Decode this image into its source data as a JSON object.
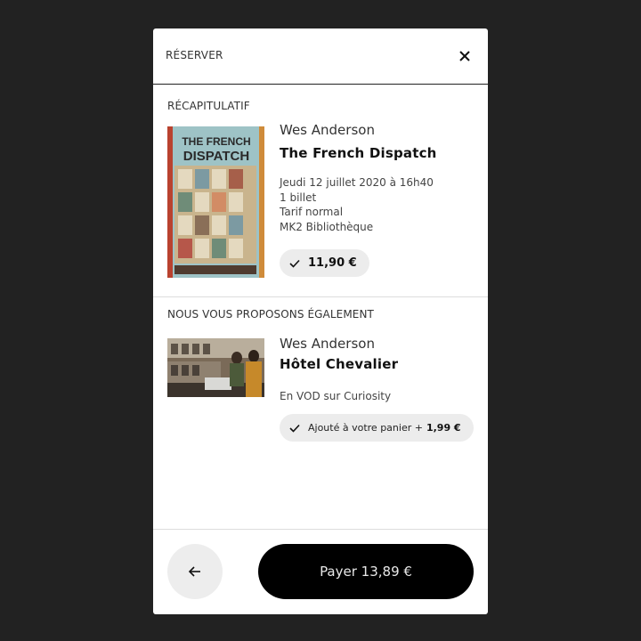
{
  "header": {
    "title": "RÉSERVER",
    "close_icon": "close-icon"
  },
  "recap": {
    "section_label": "RÉCAPITULATIF",
    "poster": {
      "line1": "THE FRENCH",
      "line2": "DISPATCH"
    },
    "director": "Wes Anderson",
    "title": "The French Dispatch",
    "details": [
      "Jeudi 12 juillet 2020 à 16h40",
      "1 billet",
      "Tarif normal",
      "MK2 Bibliothèque"
    ],
    "price": "11,90 €"
  },
  "suggestion": {
    "section_label": "NOUS VOUS PROPOSONS ÉGALEMENT",
    "director": "Wes Anderson",
    "title": "Hôtel Chevalier",
    "detail": "En VOD sur Curiosity",
    "added_label": "Ajouté à votre panier +",
    "added_price": "1,99 €"
  },
  "footer": {
    "back_icon": "arrow-left-icon",
    "pay_label": "Payer 13,89 €"
  },
  "colors": {
    "backdrop": "#222222",
    "modal": "#ffffff",
    "pill": "#ececec",
    "pay_button": "#000000"
  }
}
